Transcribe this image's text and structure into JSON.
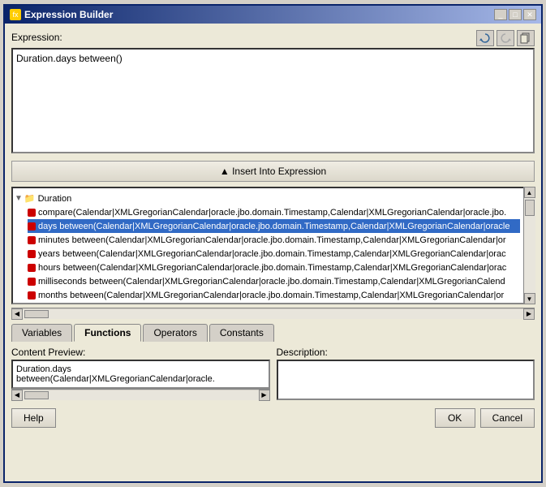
{
  "window": {
    "title": "Expression Builder",
    "icon": "fx"
  },
  "toolbar": {
    "refresh_btn": "↺",
    "back_btn": "↻",
    "copy_btn": "⎘"
  },
  "expression_label": "Expression:",
  "expression_value": "Duration.days between()",
  "insert_btn_label": "▲  Insert Into Expression",
  "tree": {
    "root_label": "Duration",
    "items": [
      "compare(Calendar|XMLGregorianCalendar|oracle.jbo.domain.Timestamp,Calendar|XMLGregorianCalendar|oracle.jbo.",
      "days between(Calendar|XMLGregorianCalendar|oracle.jbo.domain.Timestamp,Calendar|XMLGregorianCalendar|oracle",
      "minutes between(Calendar|XMLGregorianCalendar|oracle.jbo.domain.Timestamp,Calendar|XMLGregorianCalendar|or",
      "years between(Calendar|XMLGregorianCalendar|oracle.jbo.domain.Timestamp,Calendar|XMLGregorianCalendar|orac",
      "hours between(Calendar|XMLGregorianCalendar|oracle.jbo.domain.Timestamp,Calendar|XMLGregorianCalendar|orac",
      "milliseconds between(Calendar|XMLGregorianCalendar|oracle.jbo.domain.Timestamp,Calendar|XMLGregorianCalend",
      "months between(Calendar|XMLGregorianCalendar|oracle.jbo.domain.Timestamp,Calendar|XMLGregorianCalendar|or"
    ]
  },
  "tabs": [
    {
      "label": "Variables",
      "active": false
    },
    {
      "label": "Functions",
      "active": true
    },
    {
      "label": "Operators",
      "active": false
    },
    {
      "label": "Constants",
      "active": false
    }
  ],
  "content_preview_label": "Content Preview:",
  "content_preview_value": "Duration.days between(Calendar|XMLGregorianCalendar|oracle.",
  "description_label": "Description:",
  "description_value": "",
  "footer": {
    "help_label": "Help",
    "ok_label": "OK",
    "cancel_label": "Cancel"
  }
}
